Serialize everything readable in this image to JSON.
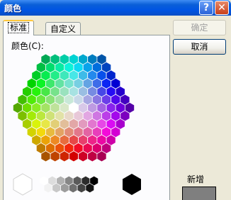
{
  "window": {
    "title": "颜色",
    "help_label": "?",
    "close_label": "✕"
  },
  "tabs": [
    {
      "label": "标准"
    },
    {
      "label": "自定义"
    }
  ],
  "colors_label": "颜色(C):",
  "buttons": {
    "ok_label": "确定",
    "cancel_label": "取消"
  },
  "new_label": "新增",
  "selected_color": "#7f7f7f"
}
